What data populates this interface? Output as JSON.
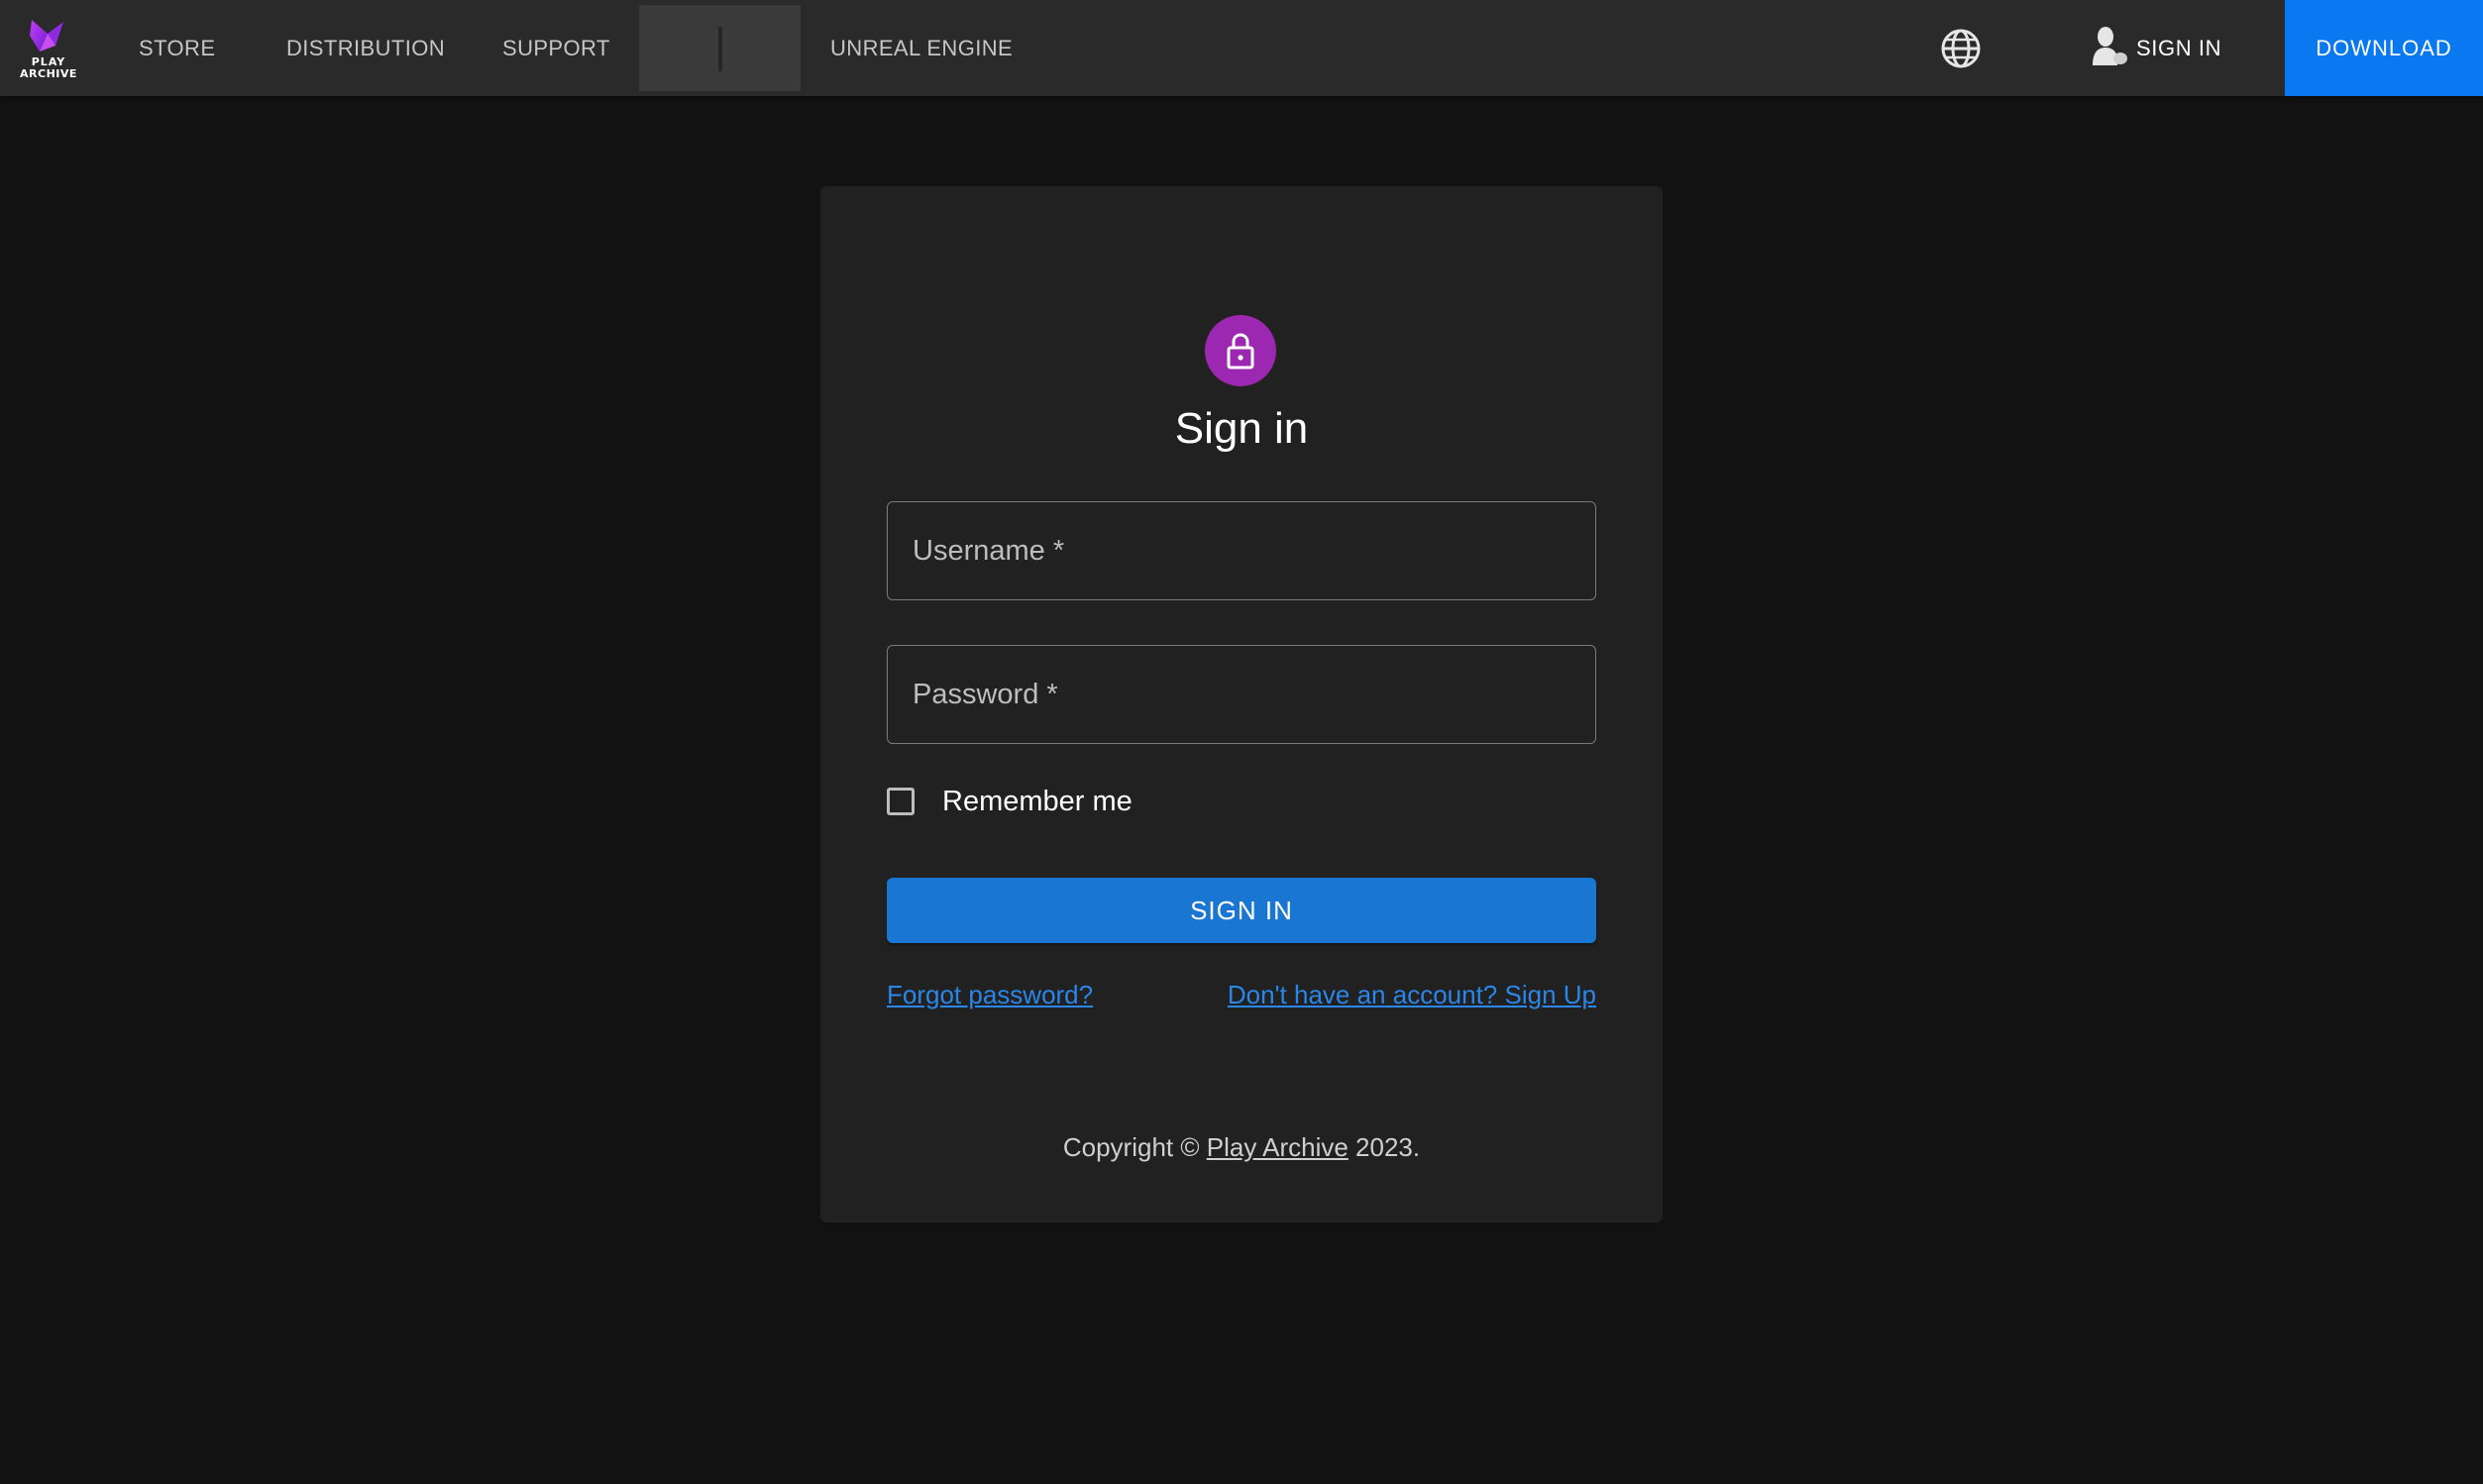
{
  "header": {
    "logo": {
      "line1": "PLAY",
      "line2": "ARCHIVE"
    },
    "nav": {
      "store": "STORE",
      "distribution": "DISTRIBUTION",
      "support": "SUPPORT",
      "unreal_engine": "UNREAL ENGINE"
    },
    "sign_in_label": "SIGN IN",
    "download_label": "DOWNLOAD",
    "colors": {
      "bar_bg": "#2a2a2a",
      "download_bg": "#0a78f0"
    }
  },
  "login": {
    "title": "Sign in",
    "username_placeholder": "Username *",
    "password_placeholder": "Password *",
    "remember_label": "Remember me",
    "remember_checked": false,
    "submit_label": "SIGN IN",
    "forgot_label": "Forgot password?",
    "signup_label": "Don't have an account? Sign Up",
    "colors": {
      "avatar": "#9c27b0",
      "submit": "#1976d2",
      "link": "#2a86e8"
    }
  },
  "footer": {
    "copyright_prefix": "Copyright © ",
    "brand": "Play Archive",
    "copyright_suffix": " 2023."
  },
  "icons": [
    "logo-icon",
    "globe-icon",
    "person-icon",
    "lock-icon",
    "checkbox-icon"
  ]
}
